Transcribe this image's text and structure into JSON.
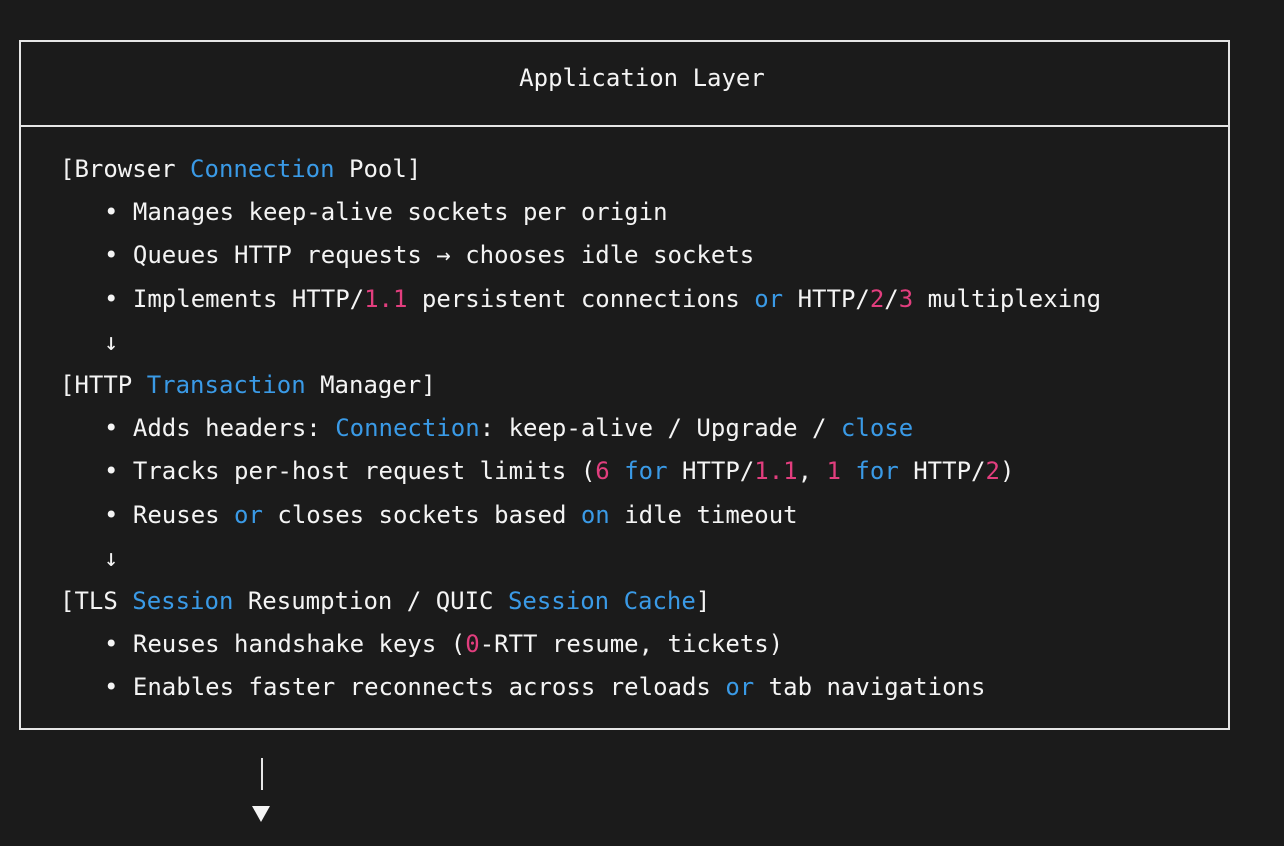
{
  "title": "Application Layer",
  "sections": [
    {
      "header": [
        {
          "t": "[Browser "
        },
        {
          "t": "Connection",
          "c": "kw"
        },
        {
          "t": " Pool]"
        }
      ],
      "bullets": [
        [
          {
            "t": "• Manages keep-alive sockets per origin"
          }
        ],
        [
          {
            "t": "• Queues HTTP requests → chooses idle sockets"
          }
        ],
        [
          {
            "t": "• Implements HTTP/"
          },
          {
            "t": "1.1",
            "c": "num"
          },
          {
            "t": " persistent connections "
          },
          {
            "t": "or",
            "c": "kw"
          },
          {
            "t": " HTTP/"
          },
          {
            "t": "2",
            "c": "num"
          },
          {
            "t": "/"
          },
          {
            "t": "3",
            "c": "num"
          },
          {
            "t": " multiplexing"
          }
        ]
      ]
    },
    {
      "header": [
        {
          "t": "[HTTP "
        },
        {
          "t": "Transaction",
          "c": "kw"
        },
        {
          "t": " Manager]"
        }
      ],
      "bullets": [
        [
          {
            "t": "• Adds headers: "
          },
          {
            "t": "Connection",
            "c": "kw"
          },
          {
            "t": ": keep-alive / Upgrade / "
          },
          {
            "t": "close",
            "c": "kw"
          }
        ],
        [
          {
            "t": "• Tracks per-host request limits ("
          },
          {
            "t": "6",
            "c": "num"
          },
          {
            "t": " "
          },
          {
            "t": "for",
            "c": "kw"
          },
          {
            "t": " HTTP/"
          },
          {
            "t": "1.1",
            "c": "num"
          },
          {
            "t": ", "
          },
          {
            "t": "1",
            "c": "num"
          },
          {
            "t": " "
          },
          {
            "t": "for",
            "c": "kw"
          },
          {
            "t": " HTTP/"
          },
          {
            "t": "2",
            "c": "num"
          },
          {
            "t": ")"
          }
        ],
        [
          {
            "t": "• Reuses "
          },
          {
            "t": "or",
            "c": "kw"
          },
          {
            "t": " closes sockets based "
          },
          {
            "t": "on",
            "c": "kw"
          },
          {
            "t": " idle timeout"
          }
        ]
      ]
    },
    {
      "header": [
        {
          "t": "[TLS "
        },
        {
          "t": "Session",
          "c": "kw"
        },
        {
          "t": " Resumption / QUIC "
        },
        {
          "t": "Session",
          "c": "kw"
        },
        {
          "t": " "
        },
        {
          "t": "Cache",
          "c": "kw"
        },
        {
          "t": "]"
        }
      ],
      "bullets": [
        [
          {
            "t": "• Reuses handshake keys ("
          },
          {
            "t": "0",
            "c": "num"
          },
          {
            "t": "-RTT resume, tickets)"
          }
        ],
        [
          {
            "t": "• Enables faster reconnects across reloads "
          },
          {
            "t": "or",
            "c": "kw"
          },
          {
            "t": " tab navigations"
          }
        ]
      ]
    }
  ],
  "flow_arrow": "↓",
  "colors": {
    "keyword": "#3a9ae6",
    "number": "#e23e7e",
    "text": "#f4f4f4",
    "background": "#1b1b1b"
  }
}
